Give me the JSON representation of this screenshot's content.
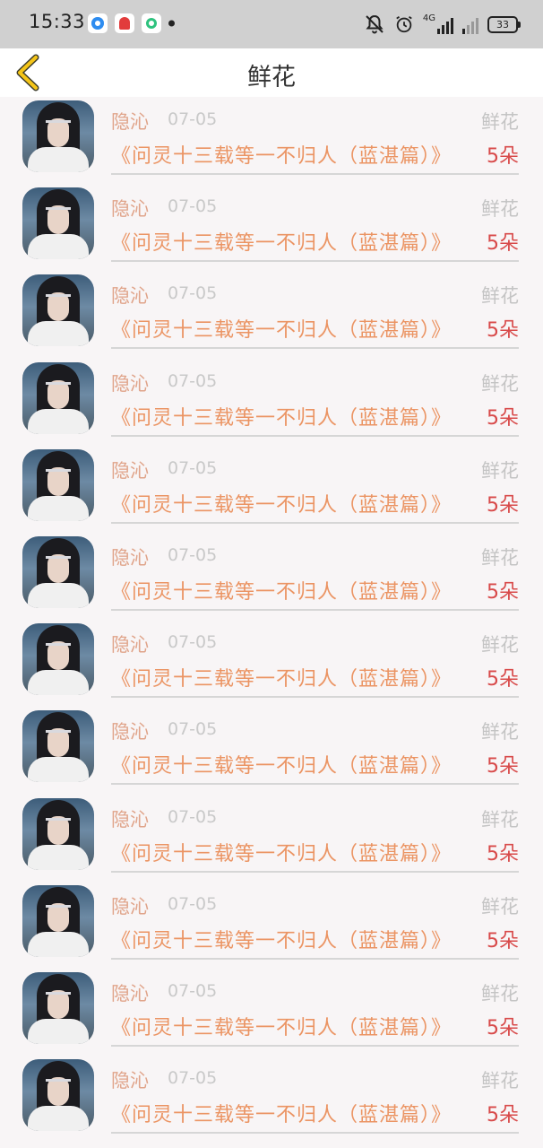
{
  "status_bar": {
    "time": "15:33",
    "network": "4G",
    "battery": "33"
  },
  "header": {
    "title": "鲜花",
    "back_icon": "chevron-left-icon",
    "accent_color": "#f5c518"
  },
  "flowers": [
    {
      "user": "隐沁",
      "date": "07-05",
      "type": "鲜花",
      "book": "《问灵十三载等一不归人（蓝湛篇）》",
      "count": "5朵"
    },
    {
      "user": "隐沁",
      "date": "07-05",
      "type": "鲜花",
      "book": "《问灵十三载等一不归人（蓝湛篇）》",
      "count": "5朵"
    },
    {
      "user": "隐沁",
      "date": "07-05",
      "type": "鲜花",
      "book": "《问灵十三载等一不归人（蓝湛篇）》",
      "count": "5朵"
    },
    {
      "user": "隐沁",
      "date": "07-05",
      "type": "鲜花",
      "book": "《问灵十三载等一不归人（蓝湛篇）》",
      "count": "5朵"
    },
    {
      "user": "隐沁",
      "date": "07-05",
      "type": "鲜花",
      "book": "《问灵十三载等一不归人（蓝湛篇）》",
      "count": "5朵"
    },
    {
      "user": "隐沁",
      "date": "07-05",
      "type": "鲜花",
      "book": "《问灵十三载等一不归人（蓝湛篇）》",
      "count": "5朵"
    },
    {
      "user": "隐沁",
      "date": "07-05",
      "type": "鲜花",
      "book": "《问灵十三载等一不归人（蓝湛篇）》",
      "count": "5朵"
    },
    {
      "user": "隐沁",
      "date": "07-05",
      "type": "鲜花",
      "book": "《问灵十三载等一不归人（蓝湛篇）》",
      "count": "5朵"
    },
    {
      "user": "隐沁",
      "date": "07-05",
      "type": "鲜花",
      "book": "《问灵十三载等一不归人（蓝湛篇）》",
      "count": "5朵"
    },
    {
      "user": "隐沁",
      "date": "07-05",
      "type": "鲜花",
      "book": "《问灵十三载等一不归人（蓝湛篇）》",
      "count": "5朵"
    },
    {
      "user": "隐沁",
      "date": "07-05",
      "type": "鲜花",
      "book": "《问灵十三载等一不归人（蓝湛篇）》",
      "count": "5朵"
    },
    {
      "user": "隐沁",
      "date": "07-05",
      "type": "鲜花",
      "book": "《问灵十三载等一不归人（蓝湛篇）》",
      "count": "5朵"
    }
  ]
}
